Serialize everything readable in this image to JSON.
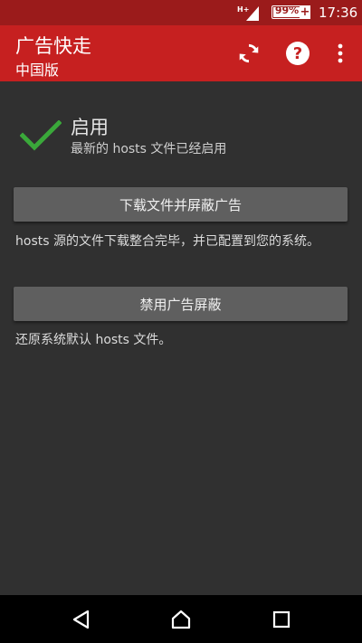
{
  "status_bar": {
    "network_label": "H+",
    "battery_percent": 99,
    "battery_text": "99%",
    "charging_symbol": "+",
    "time": "17:36"
  },
  "app_bar": {
    "title": "广告快走",
    "subtitle": "中国版",
    "actions": [
      "refresh-icon",
      "help-icon",
      "more-vert-icon"
    ]
  },
  "status": {
    "title": "启用",
    "description": "最新的 hosts 文件已经启用",
    "icon": "check-icon",
    "icon_color": "#3aa83a"
  },
  "download": {
    "button_label": "下载文件并屏蔽广告",
    "description": "hosts 源的文件下载整合完毕，并已配置到您的系统。"
  },
  "disable": {
    "button_label": "禁用广告屏蔽",
    "description": "还原系统默认 hosts 文件。"
  },
  "nav_bar": {
    "buttons": [
      "back-icon",
      "home-icon",
      "recent-apps-icon"
    ]
  },
  "colors": {
    "status_bar": "#9b1b1b",
    "app_bar": "#c62020",
    "background": "#303030",
    "button": "#5f5f5f"
  }
}
